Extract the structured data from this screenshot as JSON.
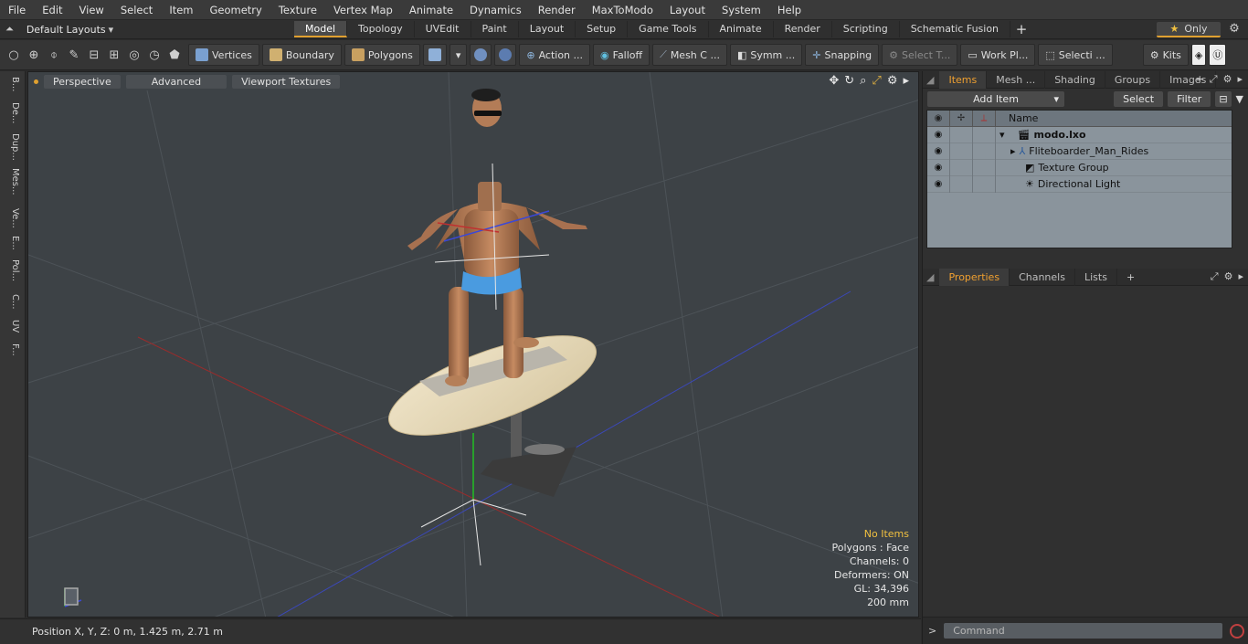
{
  "menu": [
    "File",
    "Edit",
    "View",
    "Select",
    "Item",
    "Geometry",
    "Texture",
    "Vertex Map",
    "Animate",
    "Dynamics",
    "Render",
    "MaxToModo",
    "Layout",
    "System",
    "Help"
  ],
  "layout_dropdown": "Default Layouts",
  "layout_tabs": [
    "Model",
    "Topology",
    "UVEdit",
    "Paint",
    "Layout",
    "Setup",
    "Game Tools",
    "Animate",
    "Render",
    "Scripting",
    "Schematic Fusion"
  ],
  "active_tab": "Model",
  "only_label": "Only",
  "toolbar": {
    "vertices": "Vertices",
    "boundary": "Boundary",
    "polygons": "Polygons",
    "action": "Action ...",
    "falloff": "Falloff",
    "mesh": "Mesh C ...",
    "symm": "Symm ...",
    "snapping": "Snapping",
    "select_t": "Select T...",
    "workpl": "Work Pl...",
    "selecti": "Selecti ...",
    "kits": "Kits"
  },
  "left_tabs": [
    "B...",
    "De...",
    "Dup...",
    "Mes...",
    "Ve...",
    "E...",
    "Pol...",
    "C...",
    "UV",
    "F..."
  ],
  "viewport": {
    "perspective": "Perspective",
    "advanced": "Advanced",
    "textures": "Viewport Textures",
    "stats": {
      "no_items": "No Items",
      "polygons": "Polygons : Face",
      "channels": "Channels: 0",
      "deformers": "Deformers: ON",
      "gl": "GL: 34,396",
      "scale": "200 mm"
    }
  },
  "status": {
    "position": "Position X, Y, Z:   0 m, 1.425 m, 2.71 m"
  },
  "panel_tabs": [
    "Items",
    "Mesh ...",
    "Shading",
    "Groups",
    "Images"
  ],
  "add_item": "Add Item",
  "select_btn": "Select",
  "filter_btn": "Filter",
  "name_header": "Name",
  "items": [
    {
      "name": "modo.lxo",
      "bold": true
    },
    {
      "name": "Fliteboarder_Man_Rides",
      "bold": false
    },
    {
      "name": "Texture Group",
      "bold": false
    },
    {
      "name": "Directional Light",
      "bold": false
    }
  ],
  "props_tabs": [
    "Properties",
    "Channels",
    "Lists"
  ],
  "command_placeholder": "Command"
}
